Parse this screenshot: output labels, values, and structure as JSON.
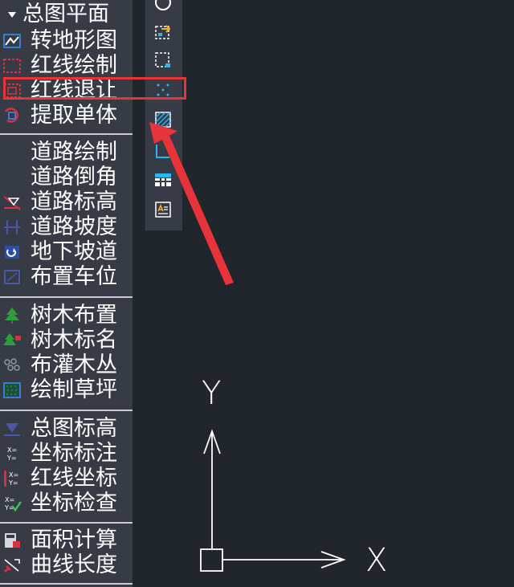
{
  "sidebar": {
    "group_header": "总图平面",
    "items": [
      {
        "label": "转地形图",
        "icon": "terrain-convert-icon"
      },
      {
        "label": "红线绘制",
        "icon": "redline-draw-icon"
      },
      {
        "label": "红线退让",
        "icon": "redline-setback-icon"
      },
      {
        "label": "提取单体",
        "icon": "extract-building-icon"
      },
      {
        "label": "道路绘制",
        "icon": "road-draw-icon"
      },
      {
        "label": "道路倒角",
        "icon": "road-fillet-icon"
      },
      {
        "label": "道路标高",
        "icon": "road-elevation-icon"
      },
      {
        "label": "道路坡度",
        "icon": "road-slope-icon"
      },
      {
        "label": "地下坡道",
        "icon": "underground-ramp-icon"
      },
      {
        "label": "布置车位",
        "icon": "parking-space-icon"
      },
      {
        "label": "树木布置",
        "icon": "tree-place-icon"
      },
      {
        "label": "树木标名",
        "icon": "tree-label-icon"
      },
      {
        "label": "布灌木丛",
        "icon": "shrub-place-icon"
      },
      {
        "label": "绘制草坪",
        "icon": "lawn-draw-icon"
      },
      {
        "label": "总图标高",
        "icon": "site-elevation-icon"
      },
      {
        "label": "坐标标注",
        "icon": "coordinate-label-icon"
      },
      {
        "label": "红线坐标",
        "icon": "redline-coordinate-icon"
      },
      {
        "label": "坐标检查",
        "icon": "coordinate-check-icon"
      },
      {
        "label": "面积计算",
        "icon": "area-calc-icon"
      },
      {
        "label": "曲线长度",
        "icon": "curve-length-icon"
      }
    ]
  },
  "toolbar": {
    "tools": [
      "circle-icon",
      "block-insert-icon",
      "make-block-icon",
      "point-icon",
      "hatch-icon",
      "region-icon",
      "table-icon",
      "mtext-icon"
    ]
  },
  "canvas": {
    "x_axis_label": "X",
    "y_axis_label": "Y"
  },
  "colors": {
    "canvas_bg": "#21252c",
    "panel_bg": "#363b45",
    "highlight": "#e8333a",
    "accent_cyan": "#29b6f6"
  }
}
